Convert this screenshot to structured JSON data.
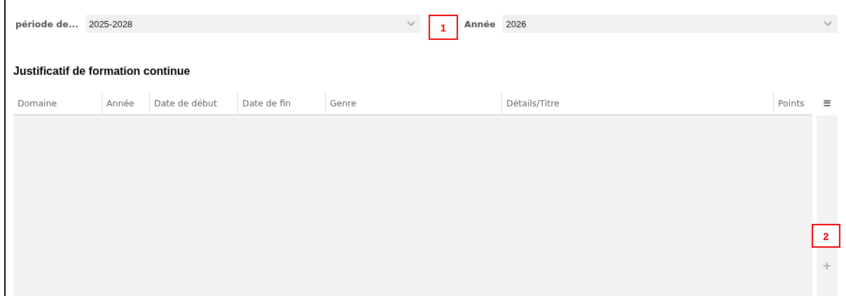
{
  "filters": [
    {
      "label": "période de...",
      "value": "2025-2028"
    },
    {
      "label": "Année",
      "value": "2026"
    }
  ],
  "section": {
    "title": "Justificatif de formation continue"
  },
  "table": {
    "columns": [
      "Domaine",
      "Année",
      "Date de début",
      "Date de fin",
      "Genre",
      "Détails/Titre",
      "Points"
    ],
    "menu_icon": "≡",
    "add_icon": "+"
  },
  "callouts": [
    "1",
    "2"
  ]
}
